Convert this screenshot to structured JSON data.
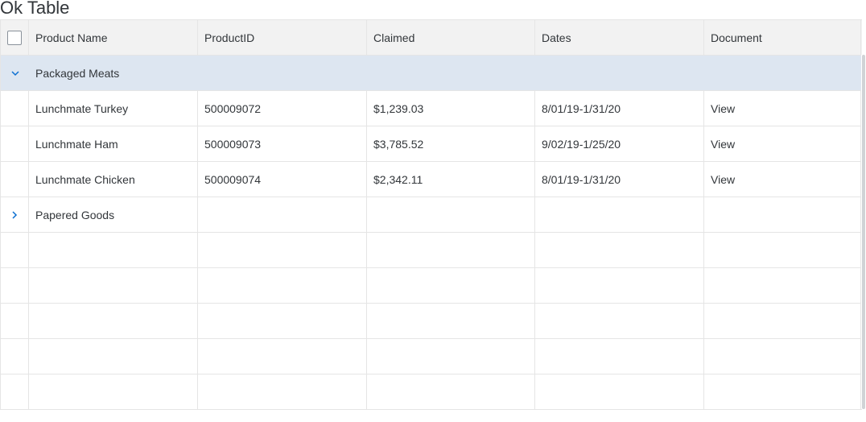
{
  "title": "Ok Table",
  "columns": [
    "Product Name",
    "ProductID",
    "Claimed",
    "Dates",
    "Document"
  ],
  "groups": [
    {
      "label": "Packaged Meats",
      "expanded": true,
      "rows": [
        {
          "name": "Lunchmate Turkey",
          "id": "500009072",
          "claimed": "$1,239.03",
          "dates": "8/01/19-1/31/20",
          "document": "View"
        },
        {
          "name": "Lunchmate Ham",
          "id": "500009073",
          "claimed": "$3,785.52",
          "dates": "9/02/19-1/25/20",
          "document": "View"
        },
        {
          "name": "Lunchmate Chicken",
          "id": "500009074",
          "claimed": "$2,342.11",
          "dates": "8/01/19-1/31/20",
          "document": "View"
        }
      ]
    },
    {
      "label": "Papered Goods",
      "expanded": false,
      "rows": []
    }
  ],
  "icons": {
    "expanded": "chevron-down-icon",
    "collapsed": "chevron-right-icon",
    "select_all": "checkbox"
  },
  "colors": {
    "group_highlight": "#dde6f1",
    "header_bg": "#f2f2f2",
    "icon_accent": "#0a6ed1"
  }
}
